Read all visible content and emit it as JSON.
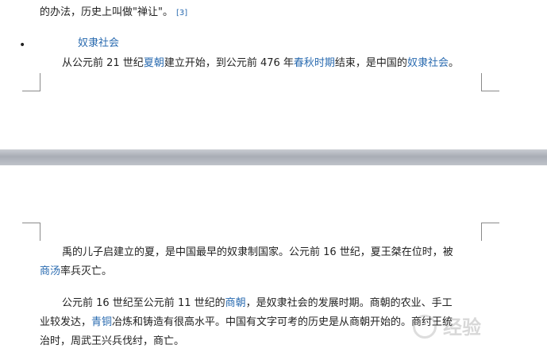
{
  "top_page": {
    "carry_line": {
      "text": "的办法，历史上叫做\"禅让\"。",
      "citation": "[3]"
    },
    "section_heading": "奴隶社会",
    "paragraph": {
      "t1": "从公元前 21 世纪",
      "l1": "夏朝",
      "t2": "建立开始，到公元前 476 年",
      "l2": "春秋时期",
      "t3": "结束，是中国的",
      "l3": "奴隶社会",
      "t4": "。"
    }
  },
  "bottom_page": {
    "para1": {
      "line1": "禹的儿子启建立的夏，是中国最早的奴隶制国家。公元前 16 世纪，夏王桀在位时，被",
      "l1": "商汤",
      "t1": "率兵灭亡。"
    },
    "para2": {
      "a1": "公元前 16 世纪至公元前 11 世纪的",
      "al": "商朝",
      "a2": "，是奴隶社会的发展时期。商朝的农业、手工",
      "b1": "业较发达，",
      "bl": "青铜",
      "b2": "冶炼和铸造有很高水平。中国有文字可考的历史是从商朝开始的。商纣王统",
      "c1": "治时，周武王兴兵伐纣，商亡。"
    }
  },
  "watermark": {
    "text": "经验"
  },
  "colors": {
    "link": "#2a6bb0",
    "text": "#222222",
    "separator": "#b3b7be"
  }
}
